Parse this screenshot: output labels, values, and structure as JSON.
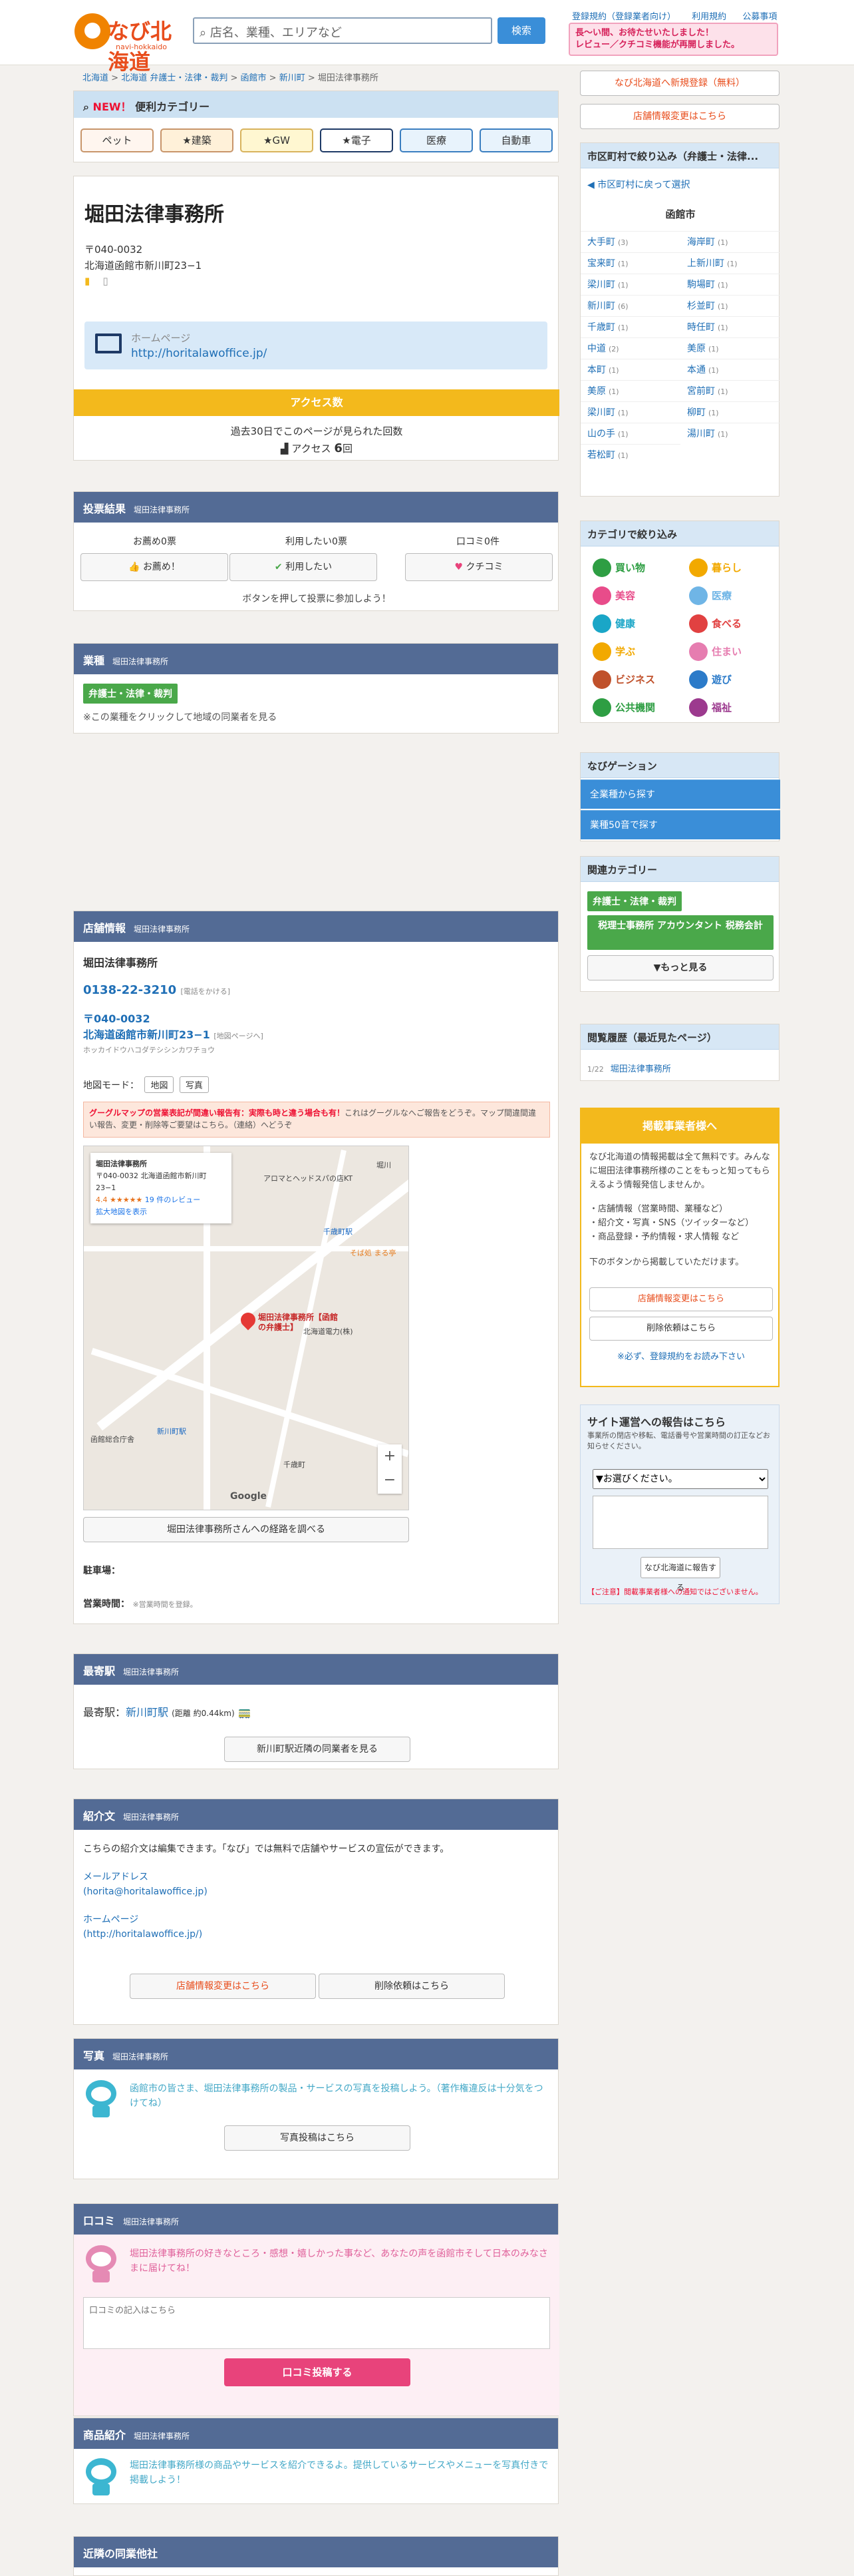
{
  "header": {
    "logo_text": "なび北海道",
    "logo_sub": "navi-hokkaido",
    "search_placeholder": "店名、業種、エリアなど",
    "search_button": "検索",
    "links": [
      "登録規約（登録業者向け）",
      "利用規約",
      "公募事項"
    ],
    "banner_line1": "長〜い間、お待たせいたしました！",
    "banner_line2": "レビュー／クチコミ機能が再開しました。"
  },
  "breadcrumb": [
    "北海道",
    "北海道 弁護士・法律・裁判",
    "函館市",
    "新川町",
    "堀田法律事務所"
  ],
  "categories": {
    "heading_new": "NEW！",
    "heading": "便利カテゴリー",
    "buttons": [
      "ペット",
      "★建築",
      "★GW",
      "★電子",
      "医療",
      "自動車"
    ]
  },
  "business": {
    "name": "堀田法律事務所",
    "zip": "〒040-0032",
    "address": "北海道函館市新川町23−1",
    "homepage_label": "ホームページ",
    "homepage_url": "http://horitalawoffice.jp/",
    "access_head": "アクセス数",
    "access_text": "過去30日でこのページが見られた回数",
    "access_count_label": "アクセス",
    "access_count": "6",
    "access_unit": "回"
  },
  "vote": {
    "title": "投票結果",
    "sub": "堀田法律事務所",
    "labels": [
      "お薦め0票",
      "利用したい0票",
      "口コミ0件"
    ],
    "buttons": [
      "お薦め！",
      "利用したい",
      "クチコミ"
    ],
    "note": "ボタンを押して投票に参加しよう！"
  },
  "gyoshu": {
    "title": "業種",
    "sub": "堀田法律事務所",
    "tag": "弁護士・法律・裁判",
    "note": "※この業種をクリックして地域の同業者を見る"
  },
  "store": {
    "title": "店舗情報",
    "sub": "堀田法律事務所",
    "name": "堀田法律事務所",
    "tel": "0138-22-3210",
    "tel_note": "[電話をかける]",
    "zip": "〒040-0032",
    "address": "北海道函館市新川町23−1",
    "map_page": "[地図ページへ]",
    "kana": "ホッカイドウハコダテシシンカワチョウ",
    "map_mode_label": "地図モード：",
    "map_modes": [
      "地図",
      "写真"
    ],
    "map_warn_bold": "グーグルマップの営業表記が間違い報告有：実際も時と違う場合も有！",
    "map_warn": "これはグーグルなへご報告をどうぞ。マップ間違間違い報告、変更・削除等ご要望はこちら。（連絡）へどうぞ",
    "map_card_name": "堀田法律事務所",
    "map_card_addr": "〒040-0032 北海道函館市新川町23−1",
    "map_card_rating": "4.4 ★★★★★",
    "map_card_reviews": "19 件のレビュー",
    "map_card_link": "拡大地図を表示",
    "map_pin_label": "堀田法律事務所【函館の弁護士】",
    "map_labels": [
      "千歳町駅",
      "新川町駅",
      "函館総合庁舎",
      "北海道電力(株)",
      "千歳町",
      "堀川",
      "アロマとヘッドスパの店KT",
      "そば処 まる亭"
    ],
    "map_copyright": "Google",
    "route_button": "堀田法律事務所さんへの経路を調べる",
    "parking_label": "駐車場：",
    "hours_label": "営業時間：",
    "hours_note": "※営業時間を登録。"
  },
  "station": {
    "title": "最寄駅",
    "sub": "堀田法律事務所",
    "label": "最寄駅：",
    "name": "新川町駅",
    "distance": "(距離 約0.44km)",
    "button": "新川町駅近隣の同業者を見る"
  },
  "intro": {
    "title": "紹介文",
    "sub": "堀田法律事務所",
    "text": "こちらの紹介文は編集できます。「なび」では無料で店舗やサービスの宣伝ができます。",
    "mail_label": "メールアドレス",
    "mail": "(horita@horitalawoffice.jp)",
    "hp_label": "ホームページ",
    "hp": "(http://horitalawoffice.jp/)",
    "btn_change": "店舗情報変更はこちら",
    "btn_delete": "削除依頼はこちら"
  },
  "photo": {
    "title": "写真",
    "sub": "堀田法律事務所",
    "text": "函館市の皆さま、堀田法律事務所の製品・サービスの写真を投稿しよう。（著作権違反は十分気をつけてね）",
    "button": "写真投稿はこちら"
  },
  "review": {
    "title": "口コミ",
    "sub": "堀田法律事務所",
    "text": "堀田法律事務所の好きなところ・感想・嬉しかった事など、あなたの声を函館市そして日本のみなさまに届けてね！",
    "placeholder": "口コミの記入はこちら",
    "button": "口コミ投稿する"
  },
  "products": {
    "title": "商品紹介",
    "sub": "堀田法律事務所",
    "text": "堀田法律事務所様の商品やサービスを紹介できるよ。提供しているサービスやメニューを写真付きで掲載しよう！"
  },
  "neighbors": {
    "title": "近隣の同業他社"
  },
  "right": {
    "btn_register": "なび北海道へ新規登録（無料）",
    "btn_change": "店舗情報変更はこちら",
    "city_head": "市区町村で絞り込み（弁護士・法律...",
    "city_back": "市区町村に戻って選択",
    "city_name": "函館市",
    "towns": [
      {
        "name": "大手町",
        "n": "(3)"
      },
      {
        "name": "海岸町",
        "n": "(1)"
      },
      {
        "name": "宝来町",
        "n": "(1)"
      },
      {
        "name": "上新川町",
        "n": "(1)"
      },
      {
        "name": "梁川町",
        "n": "(1)"
      },
      {
        "name": "駒場町",
        "n": "(1)"
      },
      {
        "name": "新川町",
        "n": "(6)"
      },
      {
        "name": "杉並町",
        "n": "(1)"
      },
      {
        "name": "千歳町",
        "n": "(1)"
      },
      {
        "name": "時任町",
        "n": "(1)"
      },
      {
        "name": "中道",
        "n": "(2)"
      },
      {
        "name": "美原",
        "n": "(1)"
      },
      {
        "name": "本町",
        "n": "(1)"
      },
      {
        "name": "本通",
        "n": "(1)"
      },
      {
        "name": "美原",
        "n": "(1)"
      },
      {
        "name": "宮前町",
        "n": "(1)"
      },
      {
        "name": "梁川町",
        "n": "(1)"
      },
      {
        "name": "柳町",
        "n": "(1)"
      },
      {
        "name": "山の手",
        "n": "(1)"
      },
      {
        "name": "湯川町",
        "n": "(1)"
      },
      {
        "name": "若松町",
        "n": "(1)"
      }
    ],
    "cat_head": "カテゴリで絞り込み",
    "cats": [
      {
        "name": "買い物",
        "color": "#2e9e43"
      },
      {
        "name": "暮らし",
        "color": "#f2a900"
      },
      {
        "name": "美容",
        "color": "#e84c8a"
      },
      {
        "name": "医療",
        "color": "#6fb5e6"
      },
      {
        "name": "健康",
        "color": "#1aa6c7"
      },
      {
        "name": "食べる",
        "color": "#e14141"
      },
      {
        "name": "学ぶ",
        "color": "#f2a900"
      },
      {
        "name": "住まい",
        "color": "#e67db0"
      },
      {
        "name": "ビジネス",
        "color": "#c0512b"
      },
      {
        "name": "遊び",
        "color": "#2c7bc9"
      },
      {
        "name": "公共機関",
        "color": "#2e9e43"
      },
      {
        "name": "福祉",
        "color": "#9c3a8e"
      }
    ],
    "navi_head": "なびゲーション",
    "navi_items": [
      "全業種から探す",
      "業種50音で探す"
    ],
    "related_head": "関連カテゴリー",
    "related_tag": "弁護士・法律・裁判",
    "related_tag2": "税理士事務所 アカウンタント 税務会計",
    "related_more": "▼もっと見る",
    "hist_head": "閲覧履歴（最近見たページ）",
    "hist_date": "1/22",
    "hist_item": "堀田法律事務所",
    "owner_head": "掲載事業者様へ",
    "owner_text1": "なび北海道の情報掲載は全て無料です。みんなに堀田法律事務所様のことをもっと知ってもらえるよう情報発信しませんか。",
    "owner_text2": "・店舗情報（営業時間、業種など）\n・紹介文・写真・SNS（ツイッターなど）\n・商品登録・予約情報・求人情報 など",
    "owner_text3": "下のボタンから掲載していただけます。",
    "owner_btn1": "店舗情報変更はこちら",
    "owner_btn2": "削除依頼はこちら",
    "owner_note": "※必ず、登録規約をお読み下さい",
    "report_head": "サイト運営への報告はこちら",
    "report_note": "事業所の閉店や移転、電話番号や営業時間の訂正などお知らせください。",
    "report_select": "▼お選びください。",
    "report_send": "なび北海道に報告する",
    "report_warn": "【ご注意】閲載事業者様への通知ではございません。"
  }
}
